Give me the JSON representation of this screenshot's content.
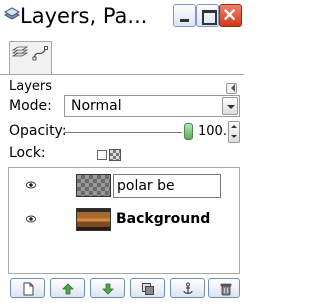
{
  "window": {
    "title": "Layers, Pa..."
  },
  "icons": {
    "app": "gimp-layers-icon",
    "tab_layers": "layers-tab-icon",
    "tab_paths": "paths-tab-icon",
    "visibility": "eye-icon",
    "chain": "chain-link-icon",
    "lock_alpha": "lock-alpha-icon",
    "panel_menu": "tab-menu-icon"
  },
  "panel": {
    "title": "Layers"
  },
  "mode": {
    "label": "Mode:",
    "value": "Normal"
  },
  "opacity": {
    "label": "Opacity:",
    "value": "100.0",
    "level": 1.0
  },
  "lock": {
    "label": "Lock:"
  },
  "layers": [
    {
      "name": "polar be",
      "visible": true,
      "editing": true,
      "thumbnail": "transparent-checker"
    },
    {
      "name": "Background",
      "visible": true,
      "editing": false,
      "thumbnail": "photo"
    }
  ],
  "bottom_buttons": [
    {
      "icon": "new-layer-icon"
    },
    {
      "icon": "raise-layer-icon"
    },
    {
      "icon": "lower-layer-icon"
    },
    {
      "icon": "duplicate-layer-icon"
    },
    {
      "icon": "anchor-layer-icon"
    },
    {
      "icon": "delete-layer-icon"
    }
  ],
  "colors": {
    "close_button": "#d1361a",
    "opacity_handle": "#5ca55c",
    "button_border": "#6f8fbf"
  }
}
